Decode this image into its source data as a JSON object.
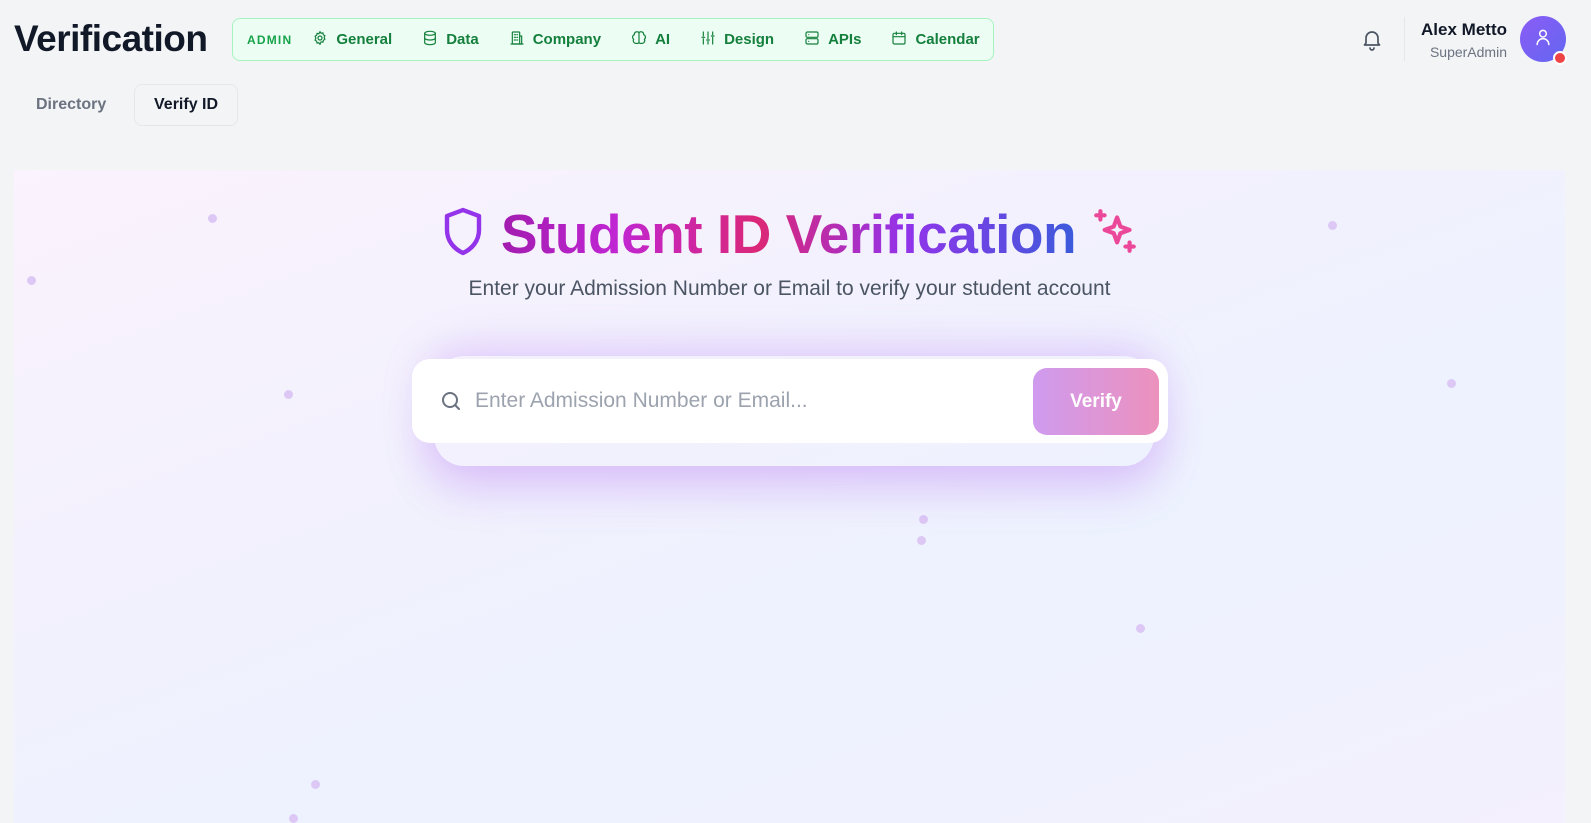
{
  "header": {
    "title": "Verification",
    "admin_badge": "ADMIN",
    "nav": [
      {
        "label": "General",
        "icon": "gear-icon"
      },
      {
        "label": "Data",
        "icon": "database-icon"
      },
      {
        "label": "Company",
        "icon": "building-icon"
      },
      {
        "label": "AI",
        "icon": "brain-icon"
      },
      {
        "label": "Design",
        "icon": "sliders-icon"
      },
      {
        "label": "APIs",
        "icon": "server-icon"
      },
      {
        "label": "Calendar",
        "icon": "calendar-icon"
      }
    ],
    "user": {
      "name": "Alex Metto",
      "role": "SuperAdmin",
      "status_color": "#ef4444"
    }
  },
  "tabs": [
    {
      "label": "Directory",
      "active": false
    },
    {
      "label": "Verify ID",
      "active": true
    }
  ],
  "hero": {
    "title": "Student ID Verification",
    "subtitle": "Enter your Admission Number or Email to verify your student account"
  },
  "search": {
    "placeholder": "Enter Admission Number or Email...",
    "value": "",
    "button_label": "Verify"
  },
  "colors": {
    "admin_accent": "#15803d",
    "title_gradient_start": "#a21caf",
    "title_gradient_end": "#3b5bdb",
    "button_gradient_start": "#cf9bef",
    "button_gradient_end": "#ec91bd"
  }
}
